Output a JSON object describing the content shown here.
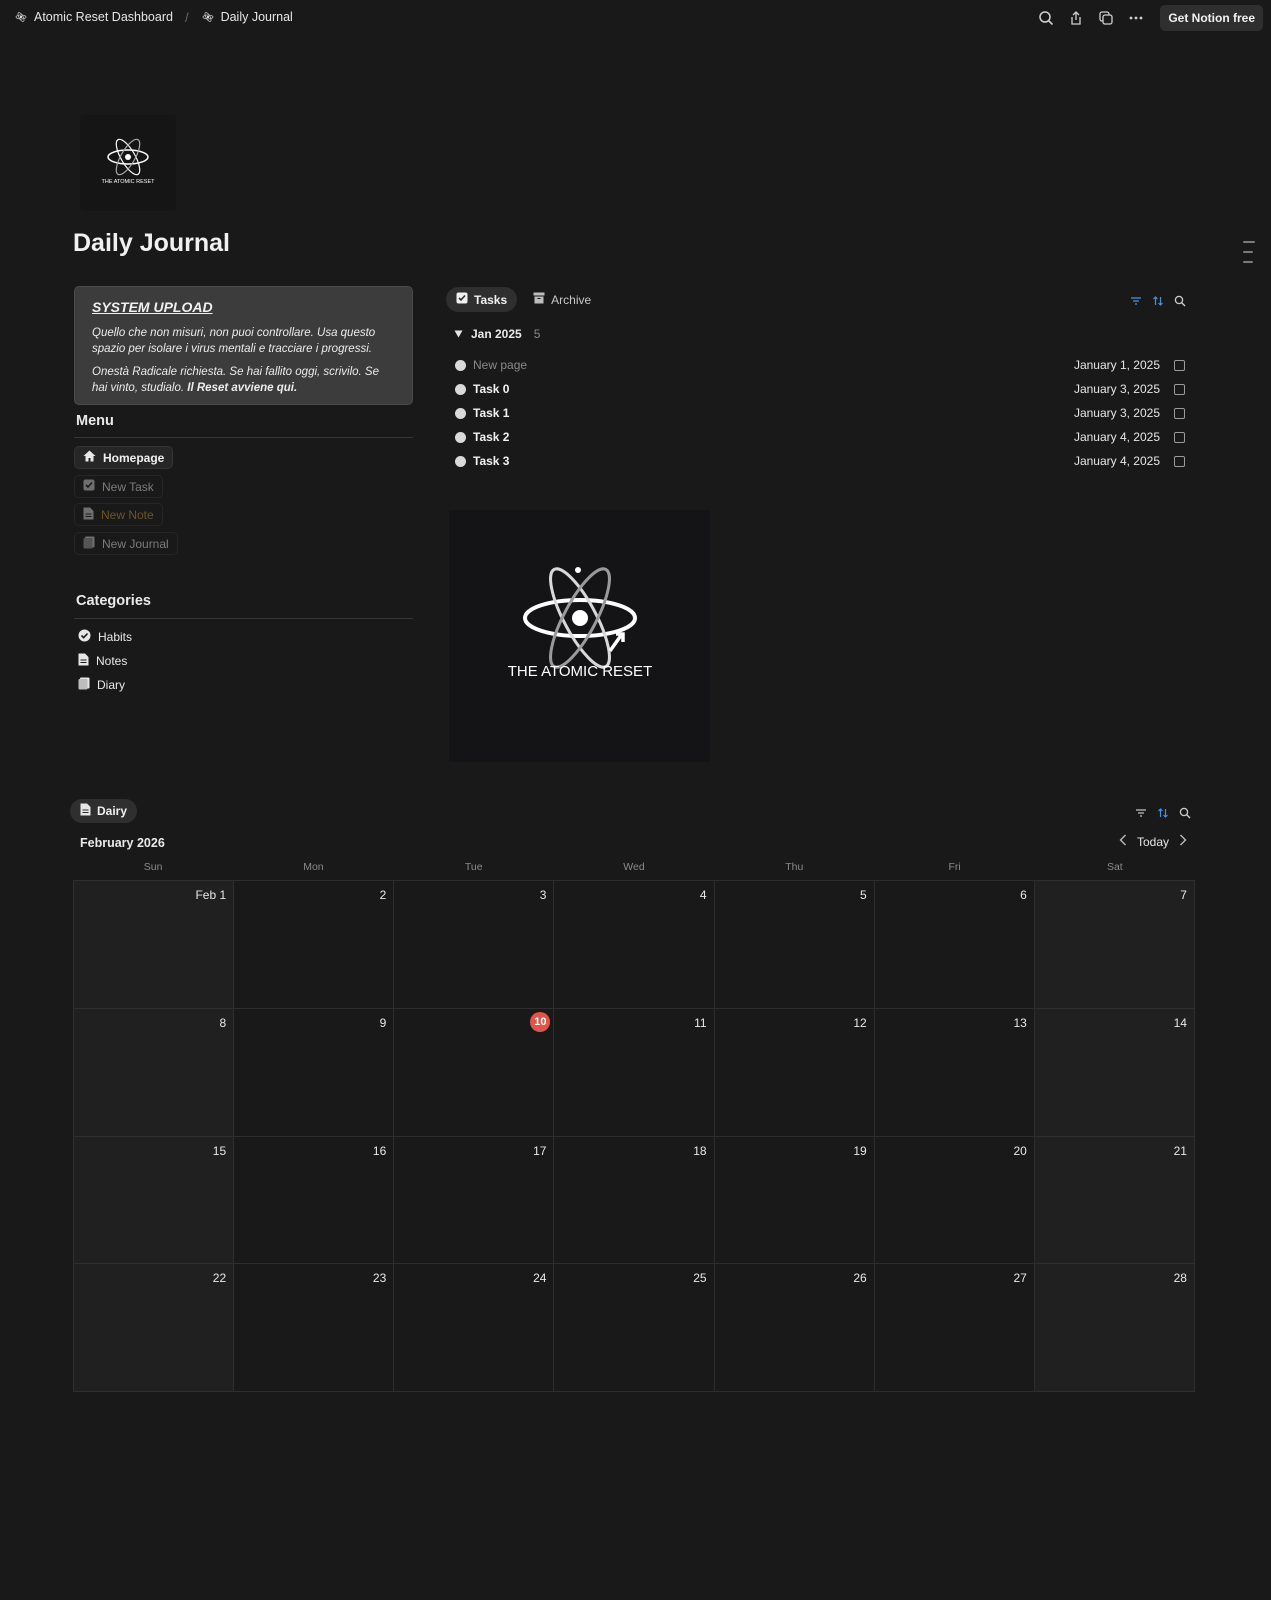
{
  "topbar": {
    "breadcrumbs": [
      "Atomic Reset Dashboard",
      "Daily Journal"
    ],
    "separator": "/",
    "cta": "Get Notion free"
  },
  "page": {
    "title": "Daily Journal",
    "icon": "atomic-reset-logo",
    "icon_text": "THE ATOMIC RESET"
  },
  "callout": {
    "title": "SYSTEM UPLOAD",
    "p1": "Quello che non misuri, non puoi controllare. Usa questo spazio per isolare i virus mentali e tracciare i progressi.",
    "p2": "Onestà Radicale richiesta. Se hai fallito oggi, scrivilo. Se hai vinto, studialo.",
    "p2_bold": "Il Reset avviene qui."
  },
  "menu": {
    "heading": "Menu",
    "items": [
      {
        "label": "Homepage",
        "icon": "home-icon"
      },
      {
        "label": "New Task",
        "icon": "checkbox-icon"
      },
      {
        "label": "New Note",
        "icon": "document-icon"
      },
      {
        "label": "New Journal",
        "icon": "journal-icon"
      }
    ]
  },
  "categories": {
    "heading": "Categories",
    "items": [
      {
        "label": "Habits",
        "icon": "check-circle-icon"
      },
      {
        "label": "Notes",
        "icon": "document-icon"
      },
      {
        "label": "Diary",
        "icon": "journal-icon"
      }
    ]
  },
  "tasks_db": {
    "tabs": [
      {
        "label": "Tasks",
        "icon": "checkbox-icon",
        "active": true
      },
      {
        "label": "Archive",
        "icon": "archive-icon",
        "active": false
      }
    ],
    "group": {
      "label": "Jan 2025",
      "count": "5"
    },
    "rows": [
      {
        "name": "New page",
        "date": "January 1, 2025",
        "checked": false
      },
      {
        "name": "Task 0",
        "date": "January 3, 2025",
        "checked": false
      },
      {
        "name": "Task 1",
        "date": "January 3, 2025",
        "checked": false
      },
      {
        "name": "Task 2",
        "date": "January 4, 2025",
        "checked": false
      },
      {
        "name": "Task 3",
        "date": "January 4, 2025",
        "checked": false
      }
    ]
  },
  "image": {
    "caption_text": "THE ATOMIC RESET"
  },
  "calendar": {
    "tab": "Dairy",
    "month": "February 2026",
    "today_label": "Today",
    "weekdays": [
      "Sun",
      "Mon",
      "Tue",
      "Wed",
      "Thu",
      "Fri",
      "Sat"
    ],
    "days": [
      "Feb 1",
      "2",
      "3",
      "4",
      "5",
      "6",
      "7",
      "8",
      "9",
      "10",
      "11",
      "12",
      "13",
      "14",
      "15",
      "16",
      "17",
      "18",
      "19",
      "20",
      "21",
      "22",
      "23",
      "24",
      "25",
      "26",
      "27",
      "28"
    ],
    "today": "10"
  },
  "colors": {
    "background": "#191919",
    "accent_blue": "#4a8fdc",
    "today_red": "#e0544a",
    "note_brown": "#6b5427"
  }
}
